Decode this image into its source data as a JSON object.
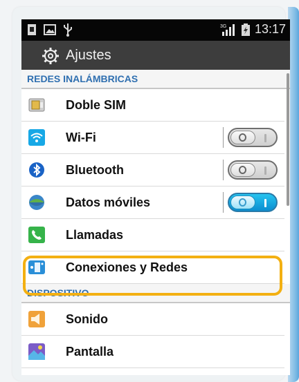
{
  "status_bar": {
    "network_label": "3G",
    "time": "13:17"
  },
  "action_bar": {
    "title": "Ajustes",
    "icon": "gear-icon"
  },
  "sections": {
    "wireless_header": "REDES INALÁMBRICAS",
    "device_header": "DISPOSITIVO"
  },
  "items": {
    "dual_sim": {
      "label": "Doble SIM",
      "icon": "sim-card-icon"
    },
    "wifi": {
      "label": "Wi-Fi",
      "icon": "wifi-icon",
      "enabled": false
    },
    "bluetooth": {
      "label": "Bluetooth",
      "icon": "bluetooth-icon",
      "enabled": false
    },
    "mobile_data": {
      "label": "Datos móviles",
      "icon": "globe-icon",
      "enabled": true
    },
    "calls": {
      "label": "Llamadas",
      "icon": "phone-icon"
    },
    "connections": {
      "label": "Conexiones y Redes",
      "icon": "connections-icon"
    },
    "sound": {
      "label": "Sonido",
      "icon": "speaker-icon"
    },
    "display": {
      "label": "Pantalla",
      "icon": "display-icon"
    }
  },
  "colors": {
    "section_header_text": "#2f6fb0",
    "highlight": "#f3b012",
    "toggle_on": "#0a8ed0"
  }
}
